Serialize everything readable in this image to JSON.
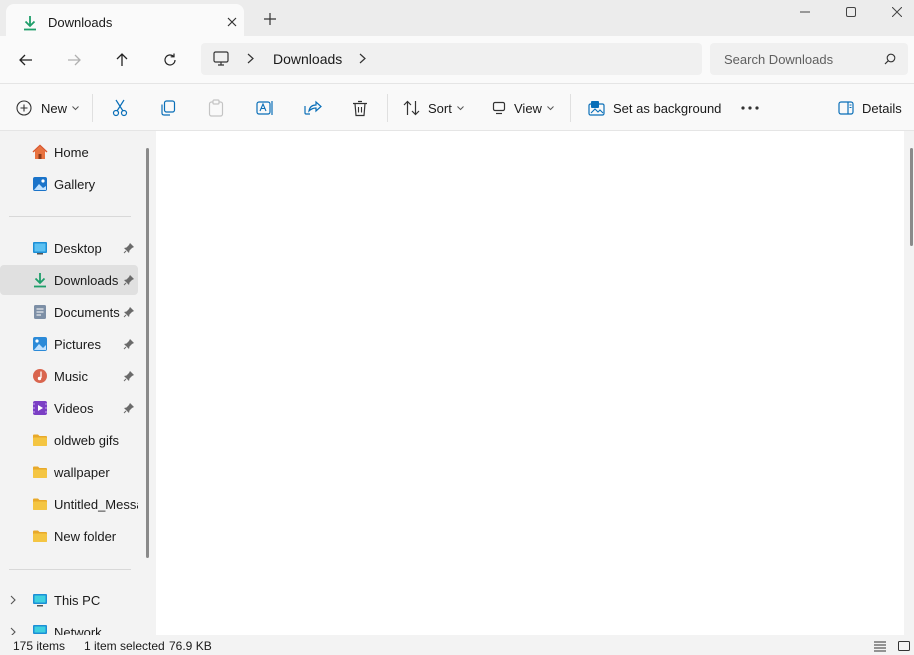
{
  "window": {
    "tab_title": "Downloads",
    "icons": [
      "download-icon",
      "close-icon",
      "plus-icon",
      "minimize-icon",
      "maximize-icon",
      "close-window-icon"
    ]
  },
  "nav": {
    "breadcrumb": [
      "Downloads"
    ],
    "search_placeholder": "Search Downloads",
    "icons": [
      "back-arrow-icon",
      "forward-arrow-icon",
      "up-arrow-icon",
      "refresh-icon",
      "monitor-icon",
      "chevron-right-icon",
      "search-icon"
    ]
  },
  "commands": {
    "new_label": "New",
    "sort_label": "Sort",
    "view_label": "View",
    "set_background_label": "Set as background",
    "details_label": "Details",
    "icons": [
      "new-plus-icon",
      "cut-icon",
      "copy-icon",
      "paste-icon",
      "rename-icon",
      "share-icon",
      "delete-icon",
      "sort-icon",
      "view-icon",
      "set-background-icon",
      "more-icon",
      "details-pane-icon"
    ]
  },
  "sidebar": {
    "top": [
      {
        "label": "Home",
        "icon": "home-icon"
      },
      {
        "label": "Gallery",
        "icon": "gallery-icon"
      }
    ],
    "quick_access": [
      {
        "label": "Desktop",
        "icon": "desktop-icon",
        "pinned": true
      },
      {
        "label": "Downloads",
        "icon": "download-icon",
        "pinned": true,
        "selected": true
      },
      {
        "label": "Documents",
        "icon": "documents-icon",
        "pinned": true
      },
      {
        "label": "Pictures",
        "icon": "pictures-icon",
        "pinned": true
      },
      {
        "label": "Music",
        "icon": "music-icon",
        "pinned": true
      },
      {
        "label": "Videos",
        "icon": "videos-icon",
        "pinned": true
      },
      {
        "label": "oldweb gifs",
        "icon": "folder-icon",
        "pinned": false
      },
      {
        "label": "wallpaper",
        "icon": "folder-icon",
        "pinned": false
      },
      {
        "label": "Untitled_Messages",
        "icon": "folder-icon",
        "pinned": false
      },
      {
        "label": "New folder",
        "icon": "folder-icon",
        "pinned": false
      }
    ],
    "bottom": [
      {
        "label": "This PC",
        "icon": "this-pc-icon"
      },
      {
        "label": "Network",
        "icon": "network-icon"
      }
    ]
  },
  "status": {
    "item_count": "175 items",
    "selection": "1 item selected",
    "size": "76.9 KB",
    "icons": [
      "details-view-icon",
      "tiles-view-icon"
    ]
  },
  "colors": {
    "accent": "#0067c0",
    "download_green": "#1f9e6a",
    "folder_yellow": "#f4c542"
  }
}
